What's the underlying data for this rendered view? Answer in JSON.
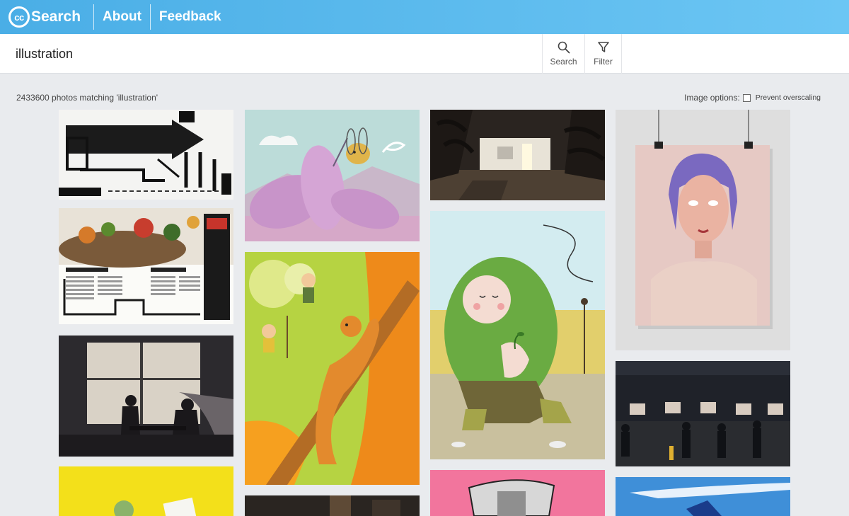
{
  "header": {
    "logo_badge": "cc",
    "logo_text": "Search",
    "nav": [
      "About",
      "Feedback"
    ]
  },
  "search": {
    "query": "illustration",
    "search_label": "Search",
    "filter_label": "Filter"
  },
  "results": {
    "count_text": "2433600 photos matching 'illustration'",
    "image_options_label": "Image options:",
    "prevent_overscaling_label": "Prevent overscaling",
    "prevent_overscaling_checked": false
  },
  "theme": {
    "header_start": "#4aaee6",
    "header_end": "#6cc6f4",
    "background": "#e9ebee"
  },
  "gallery": {
    "columns": [
      [
        {
          "name": "poster-arrows",
          "art": "arrows"
        },
        {
          "name": "magazine-spread",
          "art": "magazine"
        },
        {
          "name": "window-silhouettes",
          "art": "window"
        },
        {
          "name": "yellow-still-life",
          "art": "yellow"
        }
      ],
      [
        {
          "name": "bee-flower",
          "art": "bee"
        },
        {
          "name": "squirrel-tree",
          "art": "squirrel"
        },
        {
          "name": "dark-interior",
          "art": "dark"
        }
      ],
      [
        {
          "name": "night-house",
          "art": "night"
        },
        {
          "name": "gardener-sprout",
          "art": "gardener"
        },
        {
          "name": "pink-cup",
          "art": "pink"
        }
      ],
      [
        {
          "name": "woman-portrait-poster",
          "art": "portrait"
        },
        {
          "name": "arcade-silhouettes",
          "art": "arcade"
        },
        {
          "name": "blue-sky-shapes",
          "art": "sky"
        }
      ]
    ]
  }
}
